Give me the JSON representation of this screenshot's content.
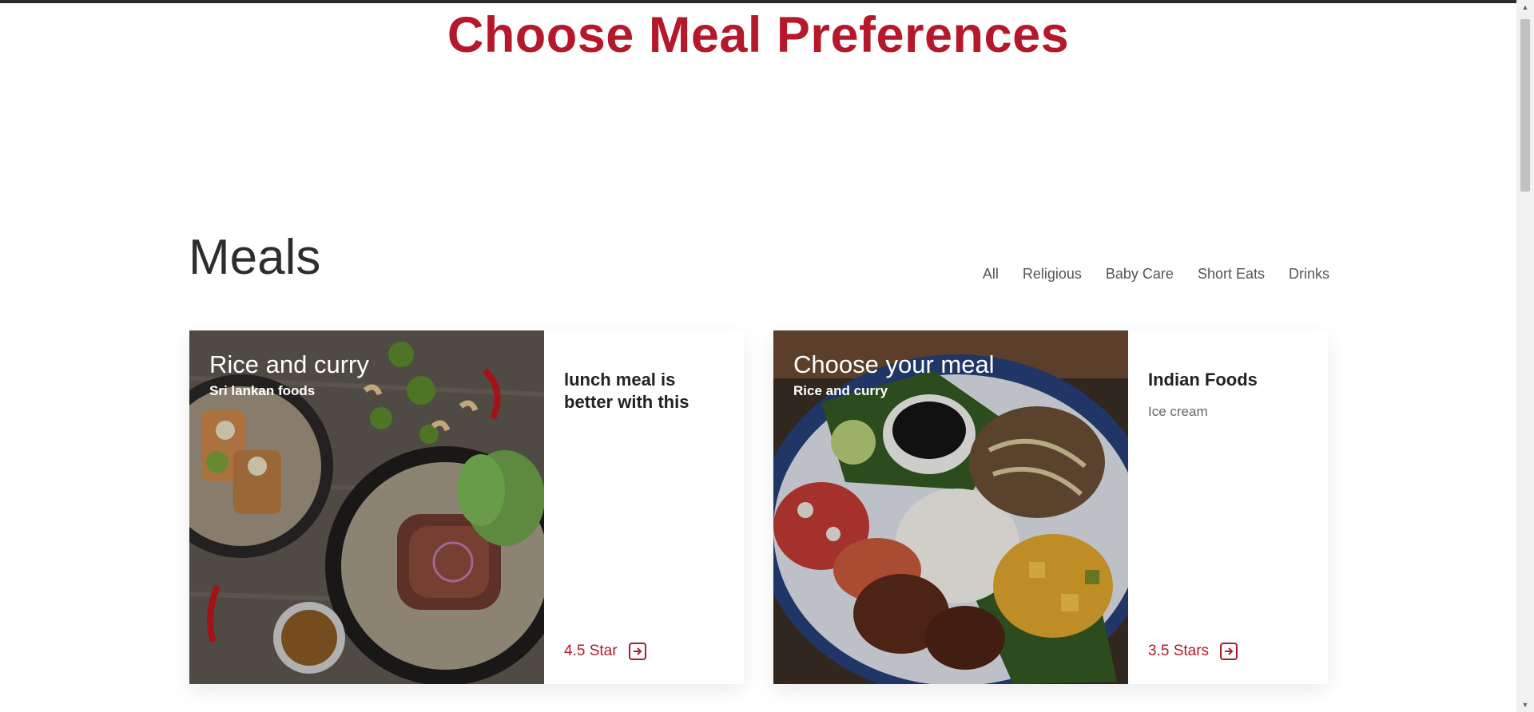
{
  "page": {
    "title": "Choose Meal Preferences"
  },
  "section": {
    "heading": "Meals"
  },
  "filters": [
    "All",
    "Religious",
    "Baby Care",
    "Short Eats",
    "Drinks"
  ],
  "cards": [
    {
      "image_title": "Rice and curry",
      "image_subtitle": "Sri lankan foods",
      "heading": "lunch meal is better with this",
      "description": "",
      "rating": "4.5 Star"
    },
    {
      "image_title": "Choose your meal",
      "image_subtitle": "Rice and curry",
      "heading": "Indian Foods",
      "description": "Ice cream",
      "rating": "3.5 Stars"
    }
  ],
  "colors": {
    "accent": "#b5182b"
  },
  "icons": {
    "rating_link": "arrow-right-square-icon"
  }
}
